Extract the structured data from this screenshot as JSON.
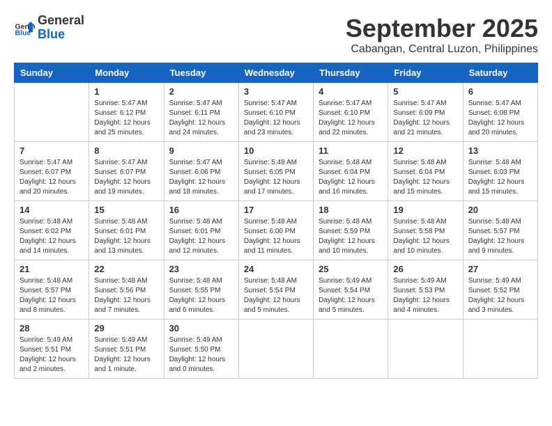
{
  "header": {
    "logo_line1": "General",
    "logo_line2": "Blue",
    "month_title": "September 2025",
    "subtitle": "Cabangan, Central Luzon, Philippines"
  },
  "weekdays": [
    "Sunday",
    "Monday",
    "Tuesday",
    "Wednesday",
    "Thursday",
    "Friday",
    "Saturday"
  ],
  "weeks": [
    [
      {
        "day": "",
        "content": ""
      },
      {
        "day": "1",
        "content": "Sunrise: 5:47 AM\nSunset: 6:12 PM\nDaylight: 12 hours\nand 25 minutes."
      },
      {
        "day": "2",
        "content": "Sunrise: 5:47 AM\nSunset: 6:11 PM\nDaylight: 12 hours\nand 24 minutes."
      },
      {
        "day": "3",
        "content": "Sunrise: 5:47 AM\nSunset: 6:10 PM\nDaylight: 12 hours\nand 23 minutes."
      },
      {
        "day": "4",
        "content": "Sunrise: 5:47 AM\nSunset: 6:10 PM\nDaylight: 12 hours\nand 22 minutes."
      },
      {
        "day": "5",
        "content": "Sunrise: 5:47 AM\nSunset: 6:09 PM\nDaylight: 12 hours\nand 21 minutes."
      },
      {
        "day": "6",
        "content": "Sunrise: 5:47 AM\nSunset: 6:08 PM\nDaylight: 12 hours\nand 20 minutes."
      }
    ],
    [
      {
        "day": "7",
        "content": "Sunrise: 5:47 AM\nSunset: 6:07 PM\nDaylight: 12 hours\nand 20 minutes."
      },
      {
        "day": "8",
        "content": "Sunrise: 5:47 AM\nSunset: 6:07 PM\nDaylight: 12 hours\nand 19 minutes."
      },
      {
        "day": "9",
        "content": "Sunrise: 5:47 AM\nSunset: 6:06 PM\nDaylight: 12 hours\nand 18 minutes."
      },
      {
        "day": "10",
        "content": "Sunrise: 5:48 AM\nSunset: 6:05 PM\nDaylight: 12 hours\nand 17 minutes."
      },
      {
        "day": "11",
        "content": "Sunrise: 5:48 AM\nSunset: 6:04 PM\nDaylight: 12 hours\nand 16 minutes."
      },
      {
        "day": "12",
        "content": "Sunrise: 5:48 AM\nSunset: 6:04 PM\nDaylight: 12 hours\nand 15 minutes."
      },
      {
        "day": "13",
        "content": "Sunrise: 5:48 AM\nSunset: 6:03 PM\nDaylight: 12 hours\nand 15 minutes."
      }
    ],
    [
      {
        "day": "14",
        "content": "Sunrise: 5:48 AM\nSunset: 6:02 PM\nDaylight: 12 hours\nand 14 minutes."
      },
      {
        "day": "15",
        "content": "Sunrise: 5:48 AM\nSunset: 6:01 PM\nDaylight: 12 hours\nand 13 minutes."
      },
      {
        "day": "16",
        "content": "Sunrise: 5:48 AM\nSunset: 6:01 PM\nDaylight: 12 hours\nand 12 minutes."
      },
      {
        "day": "17",
        "content": "Sunrise: 5:48 AM\nSunset: 6:00 PM\nDaylight: 12 hours\nand 11 minutes."
      },
      {
        "day": "18",
        "content": "Sunrise: 5:48 AM\nSunset: 5:59 PM\nDaylight: 12 hours\nand 10 minutes."
      },
      {
        "day": "19",
        "content": "Sunrise: 5:48 AM\nSunset: 5:58 PM\nDaylight: 12 hours\nand 10 minutes."
      },
      {
        "day": "20",
        "content": "Sunrise: 5:48 AM\nSunset: 5:57 PM\nDaylight: 12 hours\nand 9 minutes."
      }
    ],
    [
      {
        "day": "21",
        "content": "Sunrise: 5:48 AM\nSunset: 5:57 PM\nDaylight: 12 hours\nand 8 minutes."
      },
      {
        "day": "22",
        "content": "Sunrise: 5:48 AM\nSunset: 5:56 PM\nDaylight: 12 hours\nand 7 minutes."
      },
      {
        "day": "23",
        "content": "Sunrise: 5:48 AM\nSunset: 5:55 PM\nDaylight: 12 hours\nand 6 minutes."
      },
      {
        "day": "24",
        "content": "Sunrise: 5:48 AM\nSunset: 5:54 PM\nDaylight: 12 hours\nand 5 minutes."
      },
      {
        "day": "25",
        "content": "Sunrise: 5:49 AM\nSunset: 5:54 PM\nDaylight: 12 hours\nand 5 minutes."
      },
      {
        "day": "26",
        "content": "Sunrise: 5:49 AM\nSunset: 5:53 PM\nDaylight: 12 hours\nand 4 minutes."
      },
      {
        "day": "27",
        "content": "Sunrise: 5:49 AM\nSunset: 5:52 PM\nDaylight: 12 hours\nand 3 minutes."
      }
    ],
    [
      {
        "day": "28",
        "content": "Sunrise: 5:49 AM\nSunset: 5:51 PM\nDaylight: 12 hours\nand 2 minutes."
      },
      {
        "day": "29",
        "content": "Sunrise: 5:49 AM\nSunset: 5:51 PM\nDaylight: 12 hours\nand 1 minute."
      },
      {
        "day": "30",
        "content": "Sunrise: 5:49 AM\nSunset: 5:50 PM\nDaylight: 12 hours\nand 0 minutes."
      },
      {
        "day": "",
        "content": ""
      },
      {
        "day": "",
        "content": ""
      },
      {
        "day": "",
        "content": ""
      },
      {
        "day": "",
        "content": ""
      }
    ]
  ]
}
